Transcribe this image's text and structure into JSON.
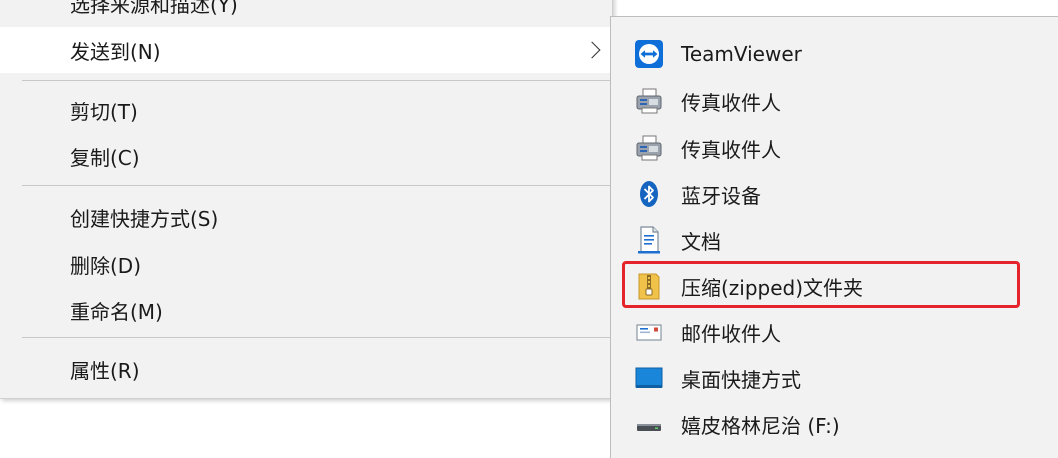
{
  "main_menu": {
    "items": [
      {
        "label": "选择来源和描述(Y)"
      },
      {
        "label": "发送到(N)",
        "has_submenu": true
      },
      {
        "label": "剪切(T)"
      },
      {
        "label": "复制(C)"
      },
      {
        "label": "创建快捷方式(S)"
      },
      {
        "label": "删除(D)"
      },
      {
        "label": "重命名(M)"
      },
      {
        "label": "属性(R)"
      }
    ]
  },
  "send_to_menu": {
    "items": [
      {
        "label": "TeamViewer",
        "icon": "teamviewer-icon"
      },
      {
        "label": "传真收件人",
        "icon": "fax-icon"
      },
      {
        "label": "传真收件人",
        "icon": "fax-icon"
      },
      {
        "label": "蓝牙设备",
        "icon": "bluetooth-icon"
      },
      {
        "label": "文档",
        "icon": "documents-icon"
      },
      {
        "label": "压缩(zipped)文件夹",
        "icon": "zip-folder-icon",
        "highlighted": true
      },
      {
        "label": "邮件收件人",
        "icon": "mail-icon"
      },
      {
        "label": "桌面快捷方式",
        "icon": "desktop-icon"
      },
      {
        "label": "嬉皮格林尼治 (F:)",
        "icon": "drive-icon"
      }
    ]
  },
  "colors": {
    "menu_bg": "#f2f2f2",
    "hover_bg": "#ffffff",
    "highlight_border": "#e5232a",
    "accent_blue": "#0e6fd8"
  }
}
